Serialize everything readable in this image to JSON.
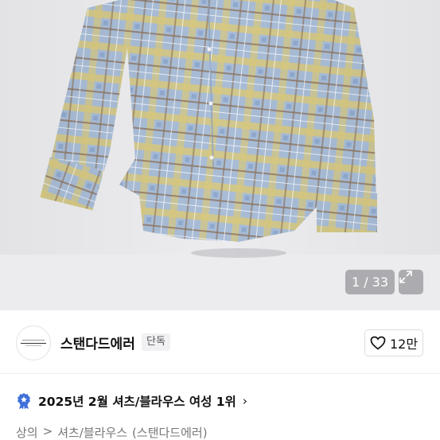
{
  "image_counter": "1 / 33",
  "seller": {
    "name": "스탠다드에러",
    "badge": "단독",
    "likes": "12만"
  },
  "ranking": {
    "text": "2025년 2월 셔츠/블라우스 여성 1위",
    "chevron": "›"
  },
  "breadcrumb": {
    "level1": "상의",
    "sep1": ">",
    "level2": "셔츠/블라우스",
    "brand": "(스탠다드에러)"
  },
  "colors": {
    "accent_blue": "#3d6fd9",
    "plaid_blue": "#9fb6d3",
    "plaid_yellow": "#d8c77a"
  },
  "icons": [
    "expand-icon",
    "heart-icon",
    "ranking-badge-icon",
    "chevron-right-icon"
  ]
}
